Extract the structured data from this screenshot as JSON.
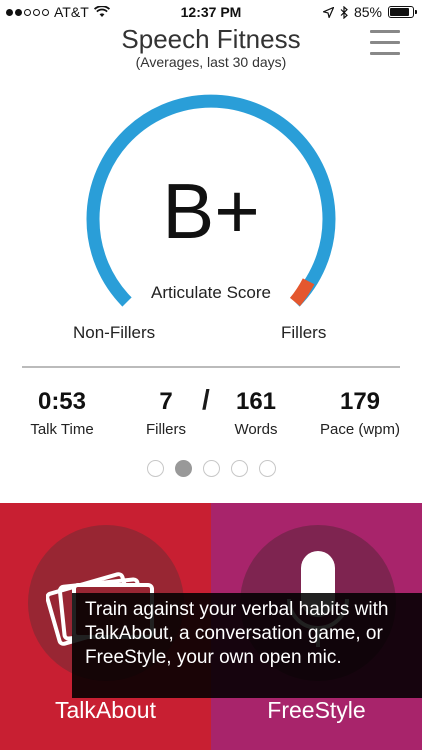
{
  "status_bar": {
    "carrier": "AT&T",
    "time": "12:37 PM",
    "battery": "85%",
    "battery_level": 0.85,
    "signal_bars_filled": 2,
    "signal_bars_total": 5
  },
  "header": {
    "title": "Speech Fitness",
    "subtitle": "(Averages, last 30 days)"
  },
  "gauge": {
    "grade": "B+",
    "label": "Articulate Score",
    "left_label": "Non-Fillers",
    "right_label": "Fillers",
    "non_filler_color": "#2a9ed8",
    "filler_color": "#e4572e"
  },
  "stats": {
    "talk_time": {
      "value": "0:53",
      "label": "Talk Time"
    },
    "fillers": {
      "value": "7",
      "label": "Fillers"
    },
    "separator": "/",
    "words": {
      "value": "161",
      "label": "Words"
    },
    "pace": {
      "value": "179",
      "label": "Pace (wpm)"
    }
  },
  "pagination": {
    "count": 5,
    "active_index": 1
  },
  "panels": {
    "talkabout": {
      "label": "TalkAbout",
      "icon": "cards-icon",
      "color": "#c81f32"
    },
    "freestyle": {
      "label": "FreeStyle",
      "icon": "microphone-icon",
      "color": "#a8246b"
    }
  },
  "tooltip": {
    "text": "Train against your verbal habits with TalkAbout, a conversation game, or FreeStyle, your own open mic."
  }
}
